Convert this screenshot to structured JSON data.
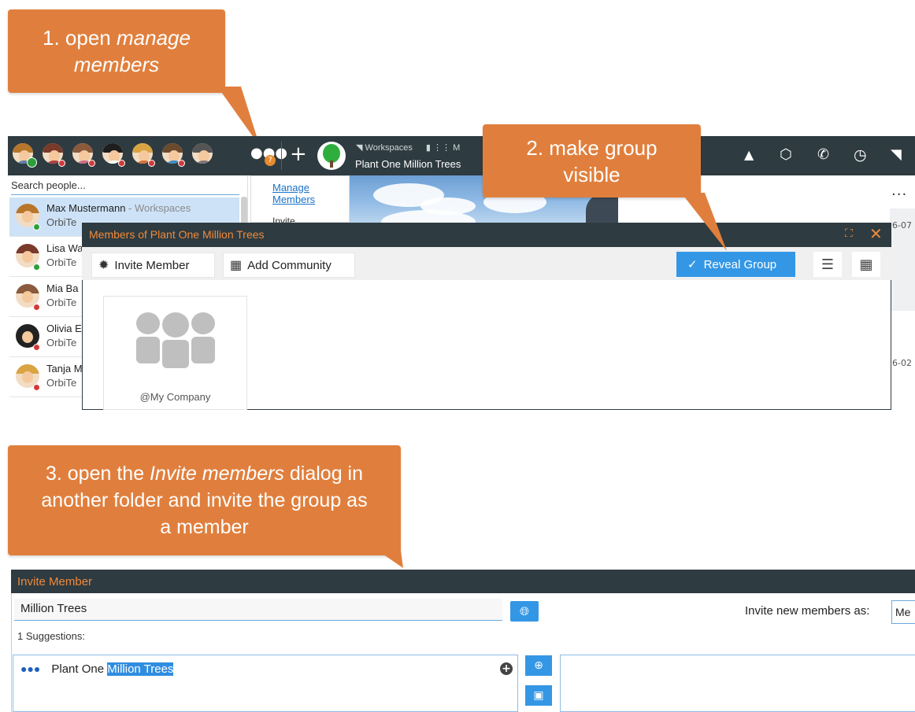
{
  "callouts": {
    "step1_prefix": "1. open ",
    "step1_em": "manage",
    "step1_line2": "members",
    "step2_line1": "2. make group",
    "step2_line2": "visible",
    "step3_line1_prefix": "3. open the ",
    "step3_line1_em": "Invite members",
    "step3_line1_suffix": " dialog in",
    "step3_line2": "another folder and invite the group as",
    "step3_line3": "a member",
    "color": "#e07f3d"
  },
  "topbar": {
    "groups_badge": "7",
    "breadcrumb_workspaces": "Workspaces",
    "breadcrumb_next": "M",
    "workspace_title": "Plant One Million Trees",
    "more_label": "..."
  },
  "people": {
    "search_placeholder": "Search people...",
    "rows": [
      {
        "name": "Max Mustermann",
        "context": " - Workspaces",
        "org": "OrbiTe"
      },
      {
        "name": "Lisa Wa",
        "context": "",
        "org": "OrbiTe"
      },
      {
        "name": "Mia Ba",
        "context": "",
        "org": "OrbiTe"
      },
      {
        "name": "Olivia E",
        "context": "",
        "org": "OrbiTe"
      },
      {
        "name": "Tanja M",
        "context": "",
        "org": "OrbiTe"
      }
    ]
  },
  "menu": {
    "manage_members_line1": "Manage",
    "manage_members_line2": "Members",
    "invite": "Invite"
  },
  "right_edge": {
    "date1": "6-07",
    "date2": "6-02"
  },
  "members_dialog": {
    "title": "Members of Plant One Million Trees",
    "invite_member": "Invite Member",
    "add_community": "Add Community",
    "reveal_group": "Reveal Group",
    "group_card_label": "@My Company",
    "accent": "#3497e6",
    "title_color": "#f08a3a"
  },
  "invite_dialog": {
    "title": "Invite Member",
    "search_value": "Million Trees",
    "invite_as_label": "Invite new members as:",
    "invite_as_value": "Me",
    "suggestions_label": "1 Suggestions:",
    "suggestion_prefix": "Plant One ",
    "suggestion_highlight": "Million Trees"
  }
}
